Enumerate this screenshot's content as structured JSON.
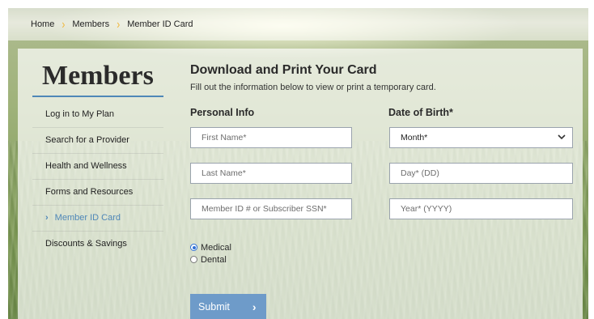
{
  "breadcrumb": {
    "items": [
      "Home",
      "Members",
      "Member ID Card"
    ],
    "separator": "›"
  },
  "sidebar": {
    "title": "Members",
    "items": [
      {
        "label": "Log in to My Plan"
      },
      {
        "label": "Search for a Provider"
      },
      {
        "label": "Health and Wellness"
      },
      {
        "label": "Forms and Resources"
      },
      {
        "label": "Member ID Card",
        "active": true
      },
      {
        "label": "Discounts & Savings"
      }
    ],
    "active_chevron": "›"
  },
  "main": {
    "heading": "Download and Print Your Card",
    "description": "Fill out the information below to view or print a temporary card."
  },
  "form": {
    "personal_info_label": "Personal Info",
    "dob_label": "Date of Birth*",
    "first_name_placeholder": "First Name*",
    "last_name_placeholder": "Last Name*",
    "member_id_placeholder": "Member ID # or Subscriber SSN*",
    "month_value": "Month*",
    "day_placeholder": "Day* (DD)",
    "year_placeholder": "Year* (YYYY)",
    "coverage_options": [
      {
        "label": "Medical",
        "checked": true
      },
      {
        "label": "Dental",
        "checked": false
      }
    ],
    "submit_label": "Submit",
    "submit_arrow": "›"
  },
  "colors": {
    "accent": "#4f87b8",
    "breadcrumb_separator": "#f0b63a",
    "submit_bg": "#6e9bc9",
    "radio_selected": "#2f6fd6"
  },
  "icons": {
    "breadcrumb_separator": "chevron-right-icon",
    "active_item": "chevron-right-icon",
    "month_select": "chevron-down-icon",
    "submit": "chevron-right-icon"
  }
}
